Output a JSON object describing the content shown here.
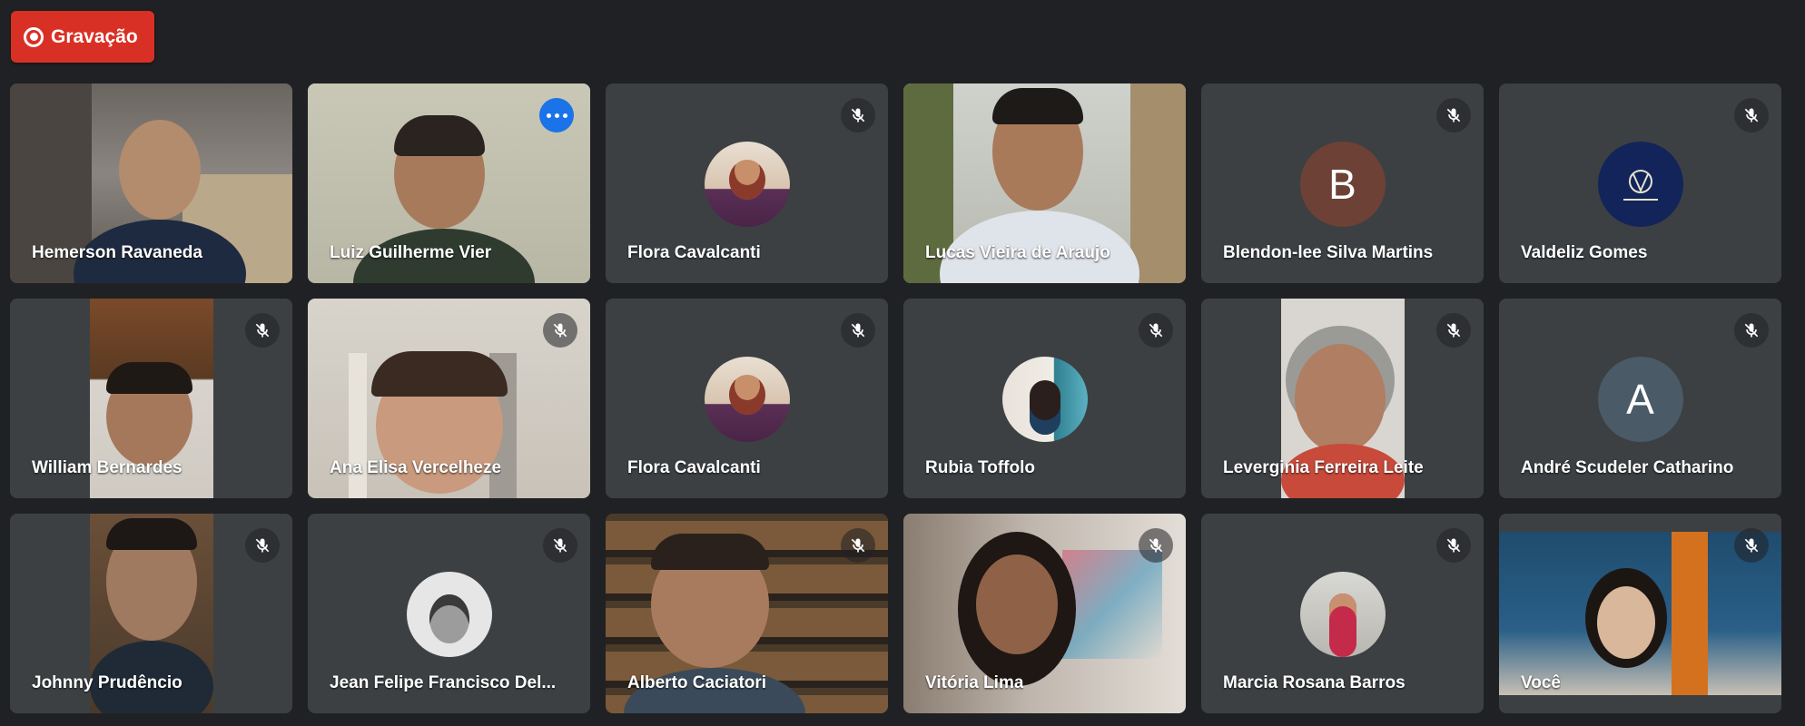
{
  "recording": {
    "label": "Gravação"
  },
  "colors": {
    "background": "#202124",
    "tile": "#3c4043",
    "record": "#d93025",
    "active_border": "#8ab4f8"
  },
  "participants": [
    {
      "name": "Hemerson Ravaneda",
      "mic": "on",
      "display": "video"
    },
    {
      "name": "Luiz Guilherme Vier",
      "mic": "on",
      "display": "video",
      "active": true,
      "menu_icon": "more-options-icon"
    },
    {
      "name": "Flora Cavalcanti",
      "mic": "muted",
      "display": "photo-avatar"
    },
    {
      "name": "Lucas Vieira de Araujo",
      "mic": "on",
      "display": "video"
    },
    {
      "name": "Blendon-lee Silva Martins",
      "mic": "muted",
      "display": "letter-avatar",
      "initial": "B",
      "avatar_color": "#6d4136"
    },
    {
      "name": "Valdeliz Gomes",
      "mic": "muted",
      "display": "logo-avatar",
      "avatar_color": "#12245a"
    },
    {
      "name": "William Bernardes",
      "mic": "muted",
      "display": "video"
    },
    {
      "name": "Ana Elisa Vercelheze",
      "mic": "muted",
      "display": "video"
    },
    {
      "name": "Flora Cavalcanti",
      "mic": "muted",
      "display": "photo-avatar"
    },
    {
      "name": "Rubia Toffolo",
      "mic": "muted",
      "display": "photo-avatar"
    },
    {
      "name": "Leverginia Ferreira Leite",
      "mic": "muted",
      "display": "video"
    },
    {
      "name": "André Scudeler Catharino",
      "mic": "muted",
      "display": "letter-avatar",
      "initial": "A",
      "avatar_color": "#4a5a66"
    },
    {
      "name": "Johnny Prudêncio",
      "mic": "muted",
      "display": "video"
    },
    {
      "name": "Jean Felipe Francisco Del...",
      "mic": "muted",
      "display": "photo-avatar"
    },
    {
      "name": "Alberto Caciatori",
      "mic": "muted",
      "display": "video"
    },
    {
      "name": "Vitória Lima",
      "mic": "muted",
      "display": "video"
    },
    {
      "name": "Marcia Rosana Barros",
      "mic": "muted",
      "display": "photo-avatar"
    },
    {
      "name": "Você",
      "mic": "muted",
      "display": "video"
    }
  ]
}
